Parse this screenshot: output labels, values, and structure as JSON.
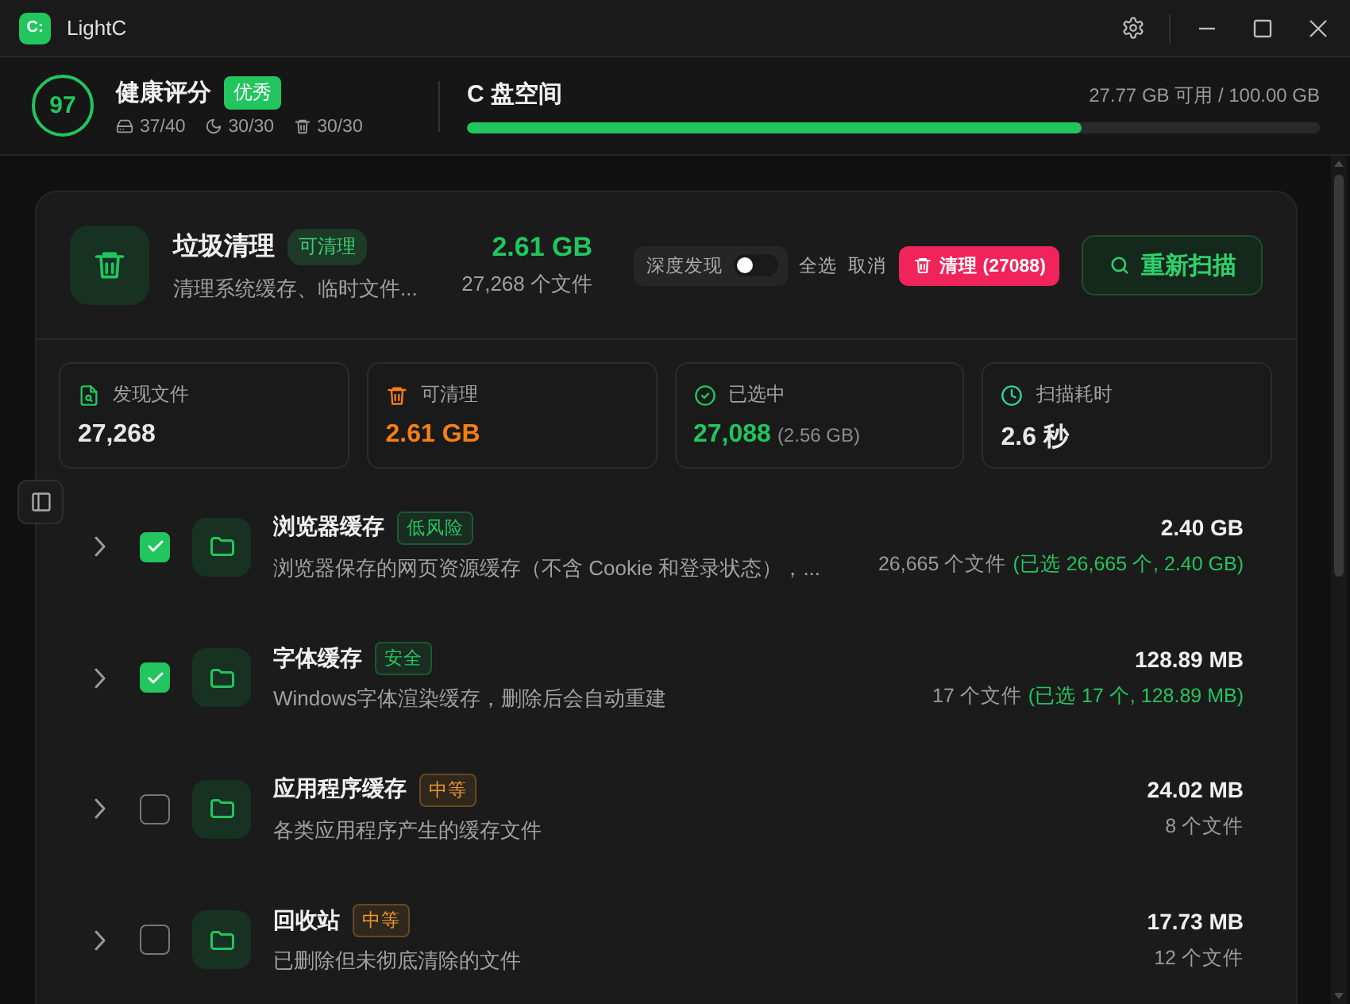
{
  "window": {
    "logo": "C:",
    "title": "LightC"
  },
  "health": {
    "score": "97",
    "title": "健康评分",
    "badge": "优秀",
    "stats": [
      "37/40",
      "30/30",
      "30/30"
    ]
  },
  "disk": {
    "title": "C 盘空间",
    "usage": "27.77 GB 可用 / 100.00 GB",
    "level": 0.72
  },
  "cleaner": {
    "title": "垃圾清理",
    "badge": "可清理",
    "subtitle": "清理系统缓存、临时文件...",
    "size": "2.61 GB",
    "files": "27,268 个文件",
    "deep_scan": {
      "label": "深度发现",
      "on": false
    },
    "select_all": "全选",
    "cancel": "取消",
    "clean_button": "清理 (27088)",
    "rescan_button": "重新扫描"
  },
  "stats": [
    {
      "label": "发现文件",
      "value": "27,268",
      "color": "#e8e8e8"
    },
    {
      "label": "可清理",
      "value": "2.61 GB",
      "color": "#f57f17"
    },
    {
      "label": "已选中",
      "value": "27,088",
      "note": "(2.56 GB)",
      "color": "#22c55e"
    },
    {
      "label": "扫描耗时",
      "value": "2.6 秒",
      "color": "#e8e8e8"
    }
  ],
  "rows": [
    {
      "name": "浏览器缓存",
      "badge": {
        "text": "低风险",
        "color": "#22c55e"
      },
      "description": "浏览器保存的网页资源缓存（不含 Cookie 和登录状态），...",
      "size": "2.40 GB",
      "files": "26,665 个文件",
      "selection": "(已选 26,665 个, 2.40 GB)",
      "checked": true,
      "expanded": false
    },
    {
      "name": "字体缓存",
      "badge": {
        "text": "安全",
        "color": "#22c55e"
      },
      "description": "Windows字体渲染缓存，删除后会自动重建",
      "size": "128.89 MB",
      "files": "17 个文件",
      "selection": "(已选 17 个, 128.89 MB)",
      "checked": true,
      "expanded": false
    },
    {
      "name": "应用程序缓存",
      "badge": {
        "text": "中等",
        "color": "#f0962e"
      },
      "description": "各类应用程序产生的缓存文件",
      "size": "24.02 MB",
      "files": "8 个文件",
      "checked": false,
      "expanded": false
    },
    {
      "name": "回收站",
      "badge": {
        "text": "中等",
        "color": "#f0962e"
      },
      "description": "已删除但未彻底清除的文件",
      "size": "17.73 MB",
      "files": "12 个文件",
      "checked": false,
      "expanded": false
    }
  ]
}
